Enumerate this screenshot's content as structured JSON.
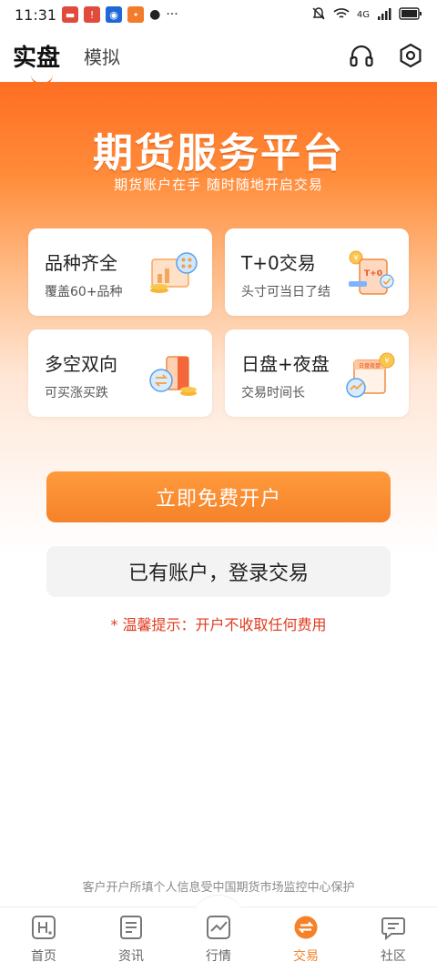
{
  "status": {
    "time": "11:31",
    "network": "4G"
  },
  "header": {
    "tabs": [
      {
        "label": "实盘"
      },
      {
        "label": "模拟"
      }
    ]
  },
  "hero": {
    "title": "期货服务平台",
    "subtitle": "期货账户在手 随时随地开启交易"
  },
  "cards": [
    {
      "title": "品种齐全",
      "subtitle": "覆盖60+品种"
    },
    {
      "title": "T+0交易",
      "subtitle": "头寸可当日了结",
      "badge": "T+0"
    },
    {
      "title": "多空双向",
      "subtitle": "可买涨买跌"
    },
    {
      "title": "日盘+夜盘",
      "subtitle": "交易时间长",
      "badge": "日盘夜盘"
    }
  ],
  "actions": {
    "open_account": "立即免费开户",
    "login": "已有账户，登录交易"
  },
  "notice": "* 温馨提示：开户不收取任何费用",
  "footer_note": "客户开户所填个人信息受中国期货市场监控中心保护",
  "bottom_nav": [
    {
      "label": "首页"
    },
    {
      "label": "资讯"
    },
    {
      "label": "行情"
    },
    {
      "label": "交易"
    },
    {
      "label": "社区"
    }
  ],
  "colors": {
    "accent": "#f5822a",
    "notice": "#e03a1e"
  }
}
